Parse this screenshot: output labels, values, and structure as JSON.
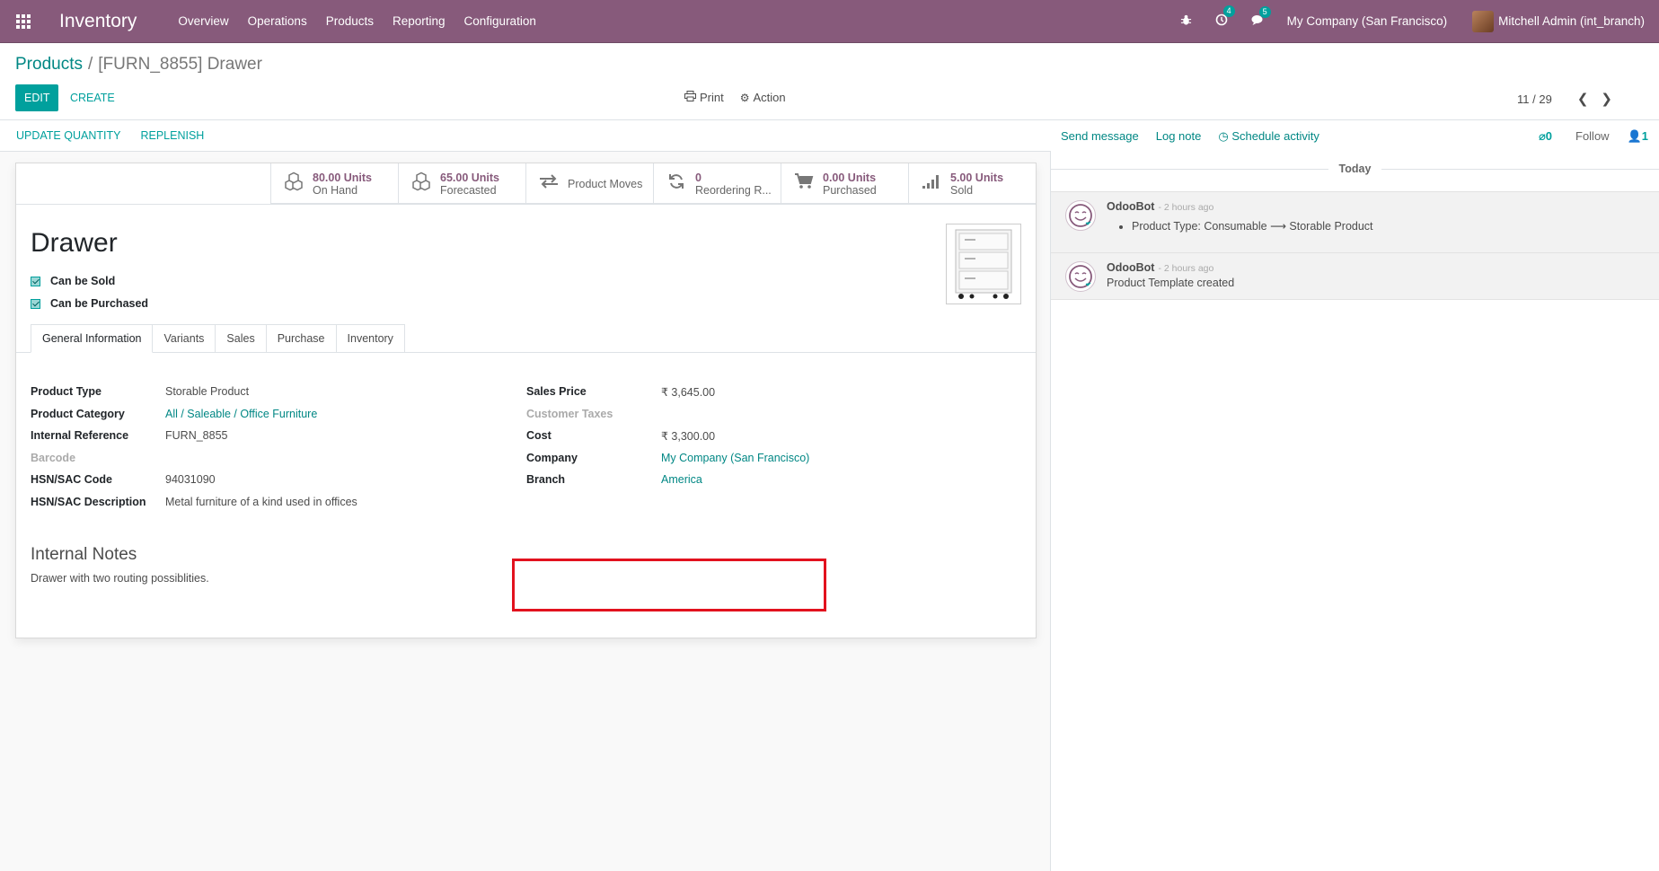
{
  "navbar": {
    "app_name": "Inventory",
    "menu": [
      "Overview",
      "Operations",
      "Products",
      "Reporting",
      "Configuration"
    ],
    "activity_count": "4",
    "messages_count": "5",
    "company": "My Company (San Francisco)",
    "user": "Mitchell Admin (int_branch)",
    "brand_color": "#875a7b"
  },
  "breadcrumb": {
    "parent": "Products",
    "separator": "/",
    "current": "[FURN_8855] Drawer"
  },
  "buttons": {
    "edit": "EDIT",
    "create": "CREATE",
    "print": "Print",
    "action": "Action"
  },
  "pager": {
    "value": "11 / 29"
  },
  "statusbar": {
    "update_quantity": "UPDATE QUANTITY",
    "replenish": "REPLENISH"
  },
  "smart_buttons": [
    {
      "value": "80.00 Units",
      "label": "On Hand",
      "icon": "cubes-icon"
    },
    {
      "value": "65.00 Units",
      "label": "Forecasted",
      "icon": "cubes-icon"
    },
    {
      "value": "",
      "label": "Product Moves",
      "icon": "exchange-icon"
    },
    {
      "value": "0",
      "label": "Reordering R...",
      "icon": "refresh-icon"
    },
    {
      "value": "0.00 Units",
      "label": "Purchased",
      "icon": "cart-icon"
    },
    {
      "value": "5.00 Units",
      "label": "Sold",
      "icon": "signal-icon"
    }
  ],
  "product": {
    "name": "Drawer",
    "can_be_sold": "Can be Sold",
    "can_be_purchased": "Can be Purchased"
  },
  "tabs": [
    "General Information",
    "Variants",
    "Sales",
    "Purchase",
    "Inventory"
  ],
  "fields_left": [
    {
      "label": "Product Type",
      "value": "Storable Product"
    },
    {
      "label": "Product Category",
      "value": "All / Saleable / Office Furniture"
    },
    {
      "label": "Internal Reference",
      "value": "FURN_8855"
    },
    {
      "label": "Barcode",
      "value": ""
    },
    {
      "label": "HSN/SAC Code",
      "value": "94031090"
    },
    {
      "label": "HSN/SAC Description",
      "value": "Metal furniture of a kind used in offices"
    }
  ],
  "fields_right": [
    {
      "label": "Sales Price",
      "value": "₹ 3,645.00"
    },
    {
      "label": "Customer Taxes",
      "value": ""
    },
    {
      "label": "Cost",
      "value": "₹ 3,300.00"
    },
    {
      "label": "Company",
      "value": "My Company (San Francisco)"
    },
    {
      "label": "Branch",
      "value": "America"
    }
  ],
  "notes": {
    "title": "Internal Notes",
    "text": "Drawer with two routing possiblities."
  },
  "chatter": {
    "send_message": "Send message",
    "log_note": "Log note",
    "schedule_activity": "Schedule activity",
    "attachments": "0",
    "follow": "Follow",
    "followers": "1",
    "date_separator": "Today",
    "messages": [
      {
        "author": "OdooBot",
        "date": "- 2 hours ago",
        "tracking": "Product Type: Consumable ⟶ Storable Product"
      },
      {
        "author": "OdooBot",
        "date": "- 2 hours ago",
        "body": "Product Template created"
      }
    ]
  },
  "highlight_color": "#e2121e"
}
